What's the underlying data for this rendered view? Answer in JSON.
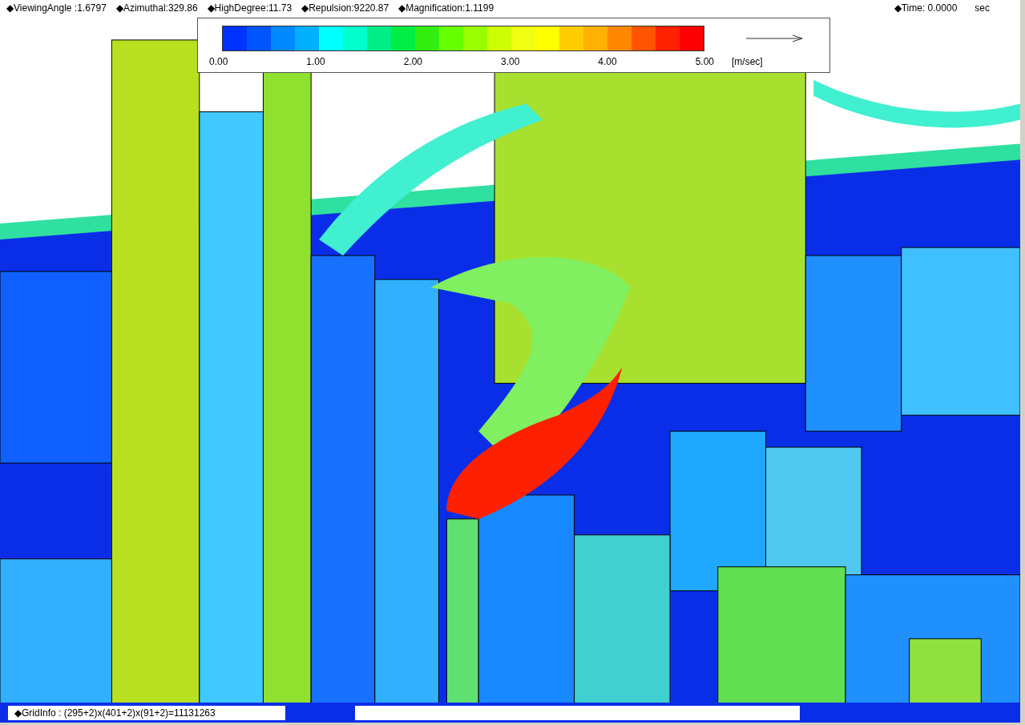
{
  "status_bar": {
    "items": [
      "◆ViewingAngle :1.6797",
      "◆Azimuthal:329.86",
      "◆HighDegree:11.73",
      "◆Repulsion:9220.87",
      "◆Magnification:1.1199"
    ],
    "time": "◆Time: 0.0000",
    "time_unit": "sec"
  },
  "legend": {
    "swatches": [
      {
        "color": "#0033ff"
      },
      {
        "color": "#0055ff"
      },
      {
        "color": "#0088ff"
      },
      {
        "color": "#00b0ff"
      },
      {
        "color": "#00ffff"
      },
      {
        "color": "#00ffcc"
      },
      {
        "color": "#00ee88"
      },
      {
        "color": "#00ee44"
      },
      {
        "color": "#33ee11"
      },
      {
        "color": "#66ff00"
      },
      {
        "color": "#99ff00"
      },
      {
        "color": "#ccff00"
      },
      {
        "color": "#eeff11"
      },
      {
        "color": "#ffff00"
      },
      {
        "color": "#ffcc00"
      },
      {
        "color": "#ffb000"
      },
      {
        "color": "#ff8800"
      },
      {
        "color": "#ff5500"
      },
      {
        "color": "#ff2200"
      },
      {
        "color": "#ff0000"
      }
    ],
    "ticks": [
      "0.00",
      "1.00",
      "2.00",
      "3.00",
      "4.00",
      "5.00"
    ],
    "unit": "[m/sec]"
  },
  "footer": {
    "grid_info": "◆GridInfo : (295+2)x(401+2)x(91+2)=11131263"
  }
}
